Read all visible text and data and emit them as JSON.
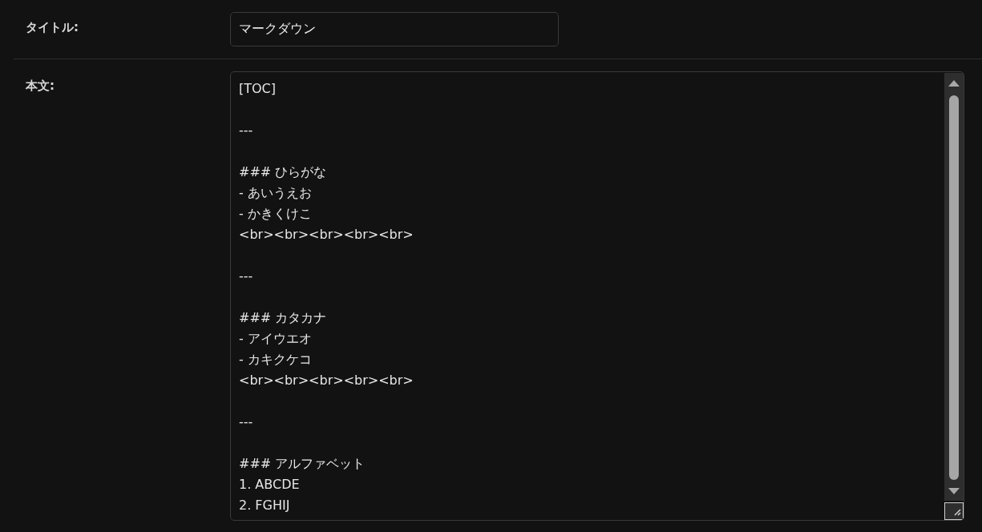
{
  "fields": [
    {
      "label": "タイトル:",
      "value": "マークダウン"
    },
    {
      "label": "本文:",
      "paragraphs": [
        [
          "[TOC]"
        ],
        [
          "---"
        ],
        [
          "### ひらがな",
          "- あいうえお",
          "- かきくけこ",
          "<br><br><br><br><br>"
        ],
        [
          "---"
        ],
        [
          "### カタカナ",
          "- アイウエオ",
          "- カキクケコ",
          "<br><br><br><br><br>"
        ],
        [
          "---"
        ],
        [
          "### アルファベット",
          "1. ABCDE",
          "2. FGHIJ"
        ]
      ]
    }
  ]
}
